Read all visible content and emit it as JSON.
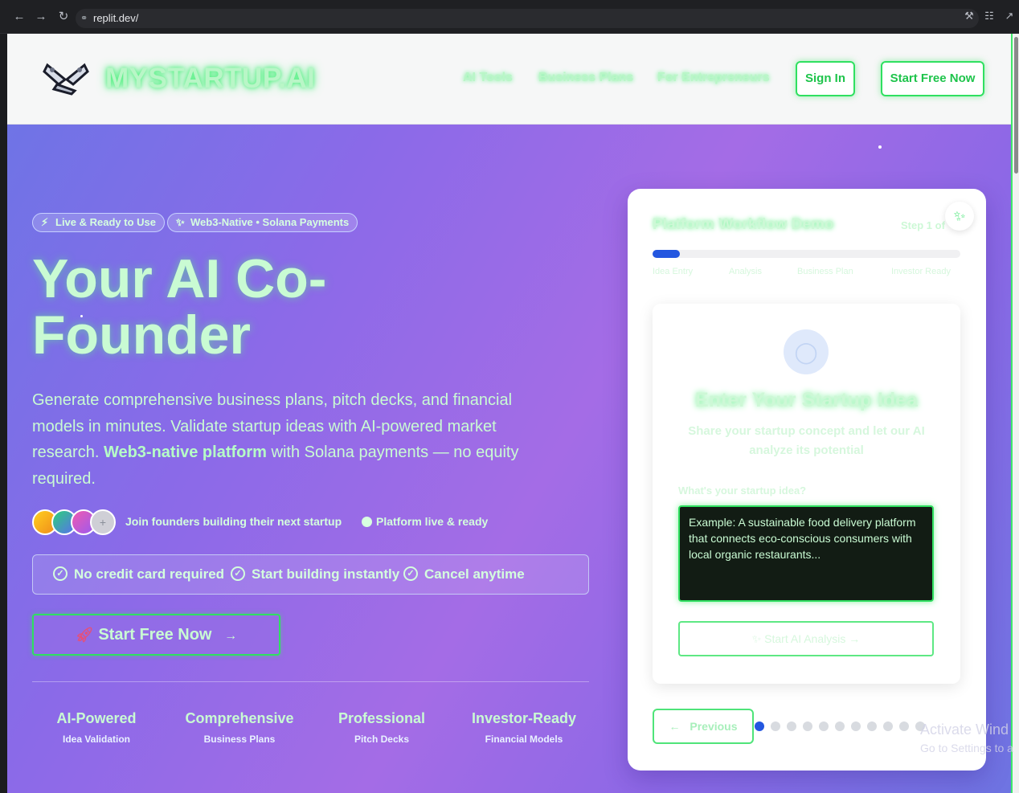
{
  "browser": {
    "url": "replit.dev/"
  },
  "header": {
    "brand": "MYSTARTUP.AI",
    "nav": [
      "AI Tools",
      "Business Plans",
      "For Entrepreneurs"
    ],
    "sign_in": "Sign In",
    "start_free": "Start Free Now"
  },
  "hero": {
    "badges": [
      "Live & Ready to Use",
      "Web3-Native • Solana Payments"
    ],
    "title_line1": "Your AI Co-",
    "title_line2": "Founder",
    "desc_part1": "Generate comprehensive business plans, pitch decks, and financial models in minutes. Validate startup ideas with AI-powered market research. ",
    "desc_bold": "Web3-native platform",
    "desc_part2": " with Solana payments — no equity required.",
    "join_text": "Join founders building their next startup",
    "live_text": "Platform live & ready",
    "checks": [
      "No credit card required",
      "Start building instantly",
      "Cancel anytime"
    ],
    "cta": "Start Free Now",
    "features": [
      {
        "title": "AI-Powered",
        "sub": "Idea Validation"
      },
      {
        "title": "Comprehensive",
        "sub": "Business Plans"
      },
      {
        "title": "Professional",
        "sub": "Pitch Decks"
      },
      {
        "title": "Investor-Ready",
        "sub": "Financial Models"
      }
    ]
  },
  "demo": {
    "title": "Platform Workflow Demo",
    "step": "Step 1 of",
    "progress": 0.09,
    "progress_labels": [
      "Idea Entry",
      "Analysis",
      "Business Plan",
      "Investor Ready"
    ],
    "heading": "Enter Your Startup Idea",
    "subheading": "Share your startup concept and let our AI analyze its potential",
    "question": "What's your startup idea?",
    "placeholder": "Example: A sustainable food delivery platform that connects eco-conscious consumers with local organic restaurants...",
    "analyze_button": "Start AI Analysis",
    "previous_button": "Previous",
    "page_count": 11,
    "active_page": 1
  },
  "watermark": {
    "line1": "Activate Wind",
    "line2": "Go to Settings to a"
  },
  "colors": {
    "neon_green": "#2fe060",
    "text_mint": "#c9fbd3",
    "accent_blue": "#2457e0"
  }
}
